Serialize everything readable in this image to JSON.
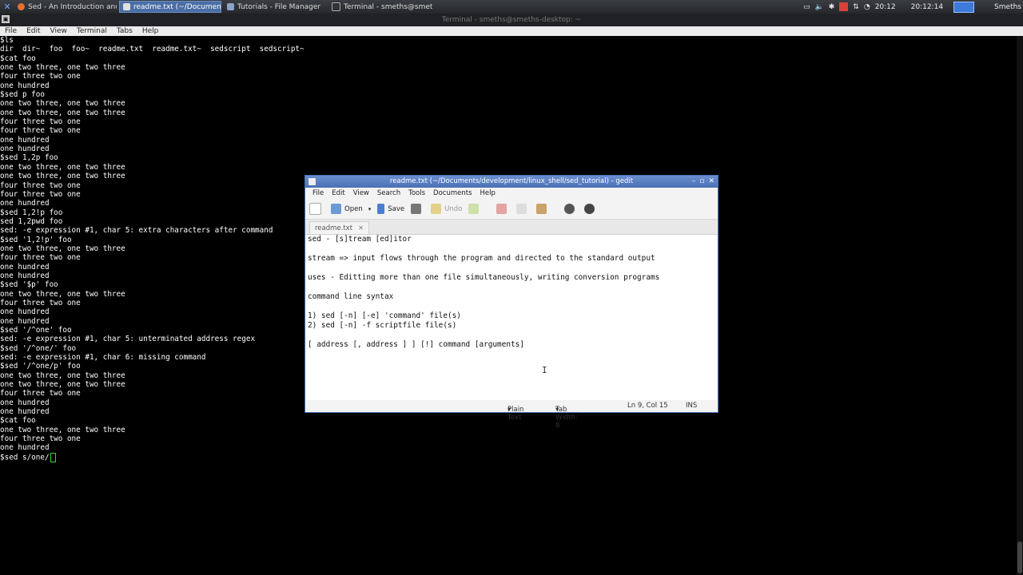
{
  "taskbar": {
    "tasks": [
      {
        "label": "Sed - An Introduction and ...",
        "icon": "firefox-icon",
        "color": "#e8702a"
      },
      {
        "label": "readme.txt (~/Documents...",
        "icon": "gedit-icon",
        "color": "#e0e0e0"
      },
      {
        "label": "Tutorials - File Manager",
        "icon": "folder-icon",
        "color": "#8aa4c8"
      },
      {
        "label": "Terminal - smeths@smeth...",
        "icon": "terminal-icon",
        "color": "#333333"
      }
    ],
    "clock_short": "20:12",
    "clock_long": "20:12:14",
    "user": "Smeths"
  },
  "terminal": {
    "title": "Terminal - smeths@smeths-desktop: ~",
    "menu": [
      "File",
      "Edit",
      "View",
      "Terminal",
      "Tabs",
      "Help"
    ],
    "lines": [
      "$ls",
      "dir  dir~  foo  foo~  readme.txt  readme.txt~  sedscript  sedscript~",
      "$cat foo",
      "one two three, one two three",
      "four three two one",
      "one hundred",
      "$sed p foo",
      "one two three, one two three",
      "one two three, one two three",
      "four three two one",
      "four three two one",
      "one hundred",
      "one hundred",
      "$sed 1,2p foo",
      "one two three, one two three",
      "one two three, one two three",
      "four three two one",
      "four three two one",
      "one hundred",
      "$sed 1,2!p foo",
      "sed 1,2pwd foo",
      "sed: -e expression #1, char 5: extra characters after command",
      "$sed '1,2!p' foo",
      "one two three, one two three",
      "four three two one",
      "one hundred",
      "one hundred",
      "$sed '$p' foo",
      "one two three, one two three",
      "four three two one",
      "one hundred",
      "one hundred",
      "$sed '/^one' foo",
      "sed: -e expression #1, char 5: unterminated address regex",
      "$sed '/^one/' foo",
      "sed: -e expression #1, char 6: missing command",
      "$sed '/^one/p' foo",
      "one two three, one two three",
      "one two three, one two three",
      "four three two one",
      "one hundred",
      "one hundred",
      "$cat foo",
      "one two three, one two three",
      "four three two one",
      "one hundred"
    ],
    "prompt_line": "$sed s/one/"
  },
  "gedit": {
    "title": "readme.txt (~/Documents/development/linux_shell/sed_tutorial) - gedit",
    "menu": [
      "File",
      "Edit",
      "View",
      "Search",
      "Tools",
      "Documents",
      "Help"
    ],
    "toolbar": {
      "open": "Open",
      "save": "Save",
      "undo": "Undo"
    },
    "tab": "readme.txt",
    "lines": [
      "sed - [s]tream [ed]itor",
      "",
      "stream => input flows through the program and directed to the standard output",
      "",
      "uses - Editting more than one file simultaneously, writing conversion programs",
      "",
      "command line syntax",
      "",
      "1) sed [-n] [-e] 'command' file(s)",
      "2) sed [-n] -f scriptfile file(s)",
      "",
      "[ address [, address ] ] [!] command [arguments]"
    ],
    "status": {
      "lang": "Plain Text",
      "tab_width": "Tab Width: 8",
      "position": "Ln 9, Col 15",
      "mode": "INS"
    }
  }
}
